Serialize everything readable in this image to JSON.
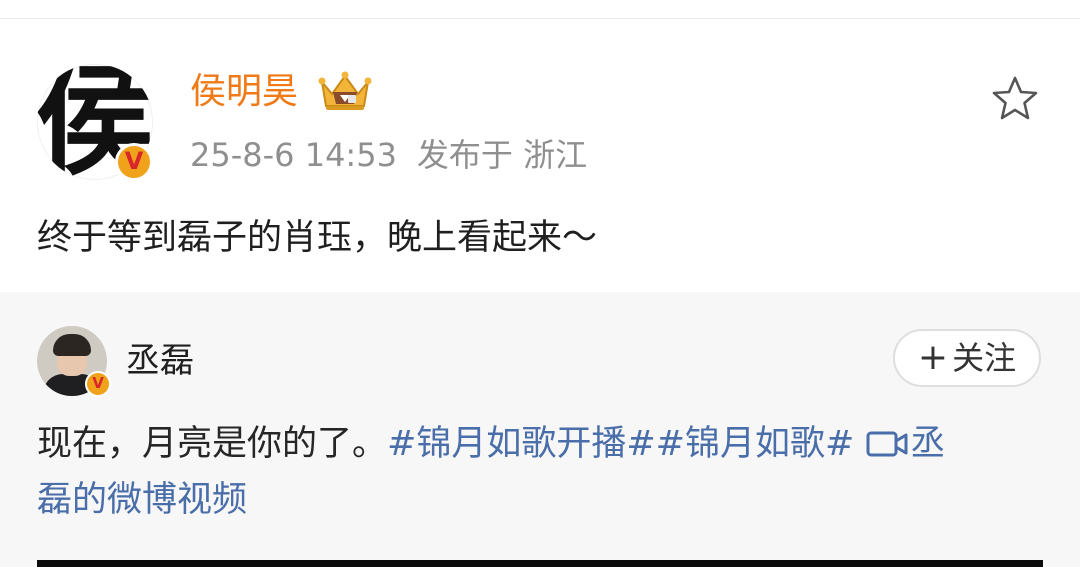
{
  "post": {
    "author_name": "侯明昊",
    "avatar_char": "侯",
    "verified_badge": "V",
    "timestamp": "25-8-6 14:53",
    "location_prefix": "发布于",
    "location": "浙江",
    "text": "终于等到磊子的肖珏，晚上看起来～",
    "icons": [
      "crown-badge-icon",
      "star-icon"
    ],
    "colors": {
      "name": "#f07a17",
      "meta": "#8f8f8f",
      "badge": "#f0a21b",
      "badge_v": "#d9262a"
    }
  },
  "repost": {
    "author_name": "丞磊",
    "verified_badge": "V",
    "follow_label": "关注",
    "follow_plus": "+",
    "text_plain": "现在，月亮是你的了。",
    "hashtag_1": "#锦月如歌开播#",
    "hashtag_2": "#锦月如歌#",
    "video_link_line1": "丞",
    "video_link_line2": "磊的微博视频",
    "icons": [
      "video-icon"
    ],
    "colors": {
      "link": "#4a6ea9",
      "background": "#f7f7f7"
    }
  }
}
